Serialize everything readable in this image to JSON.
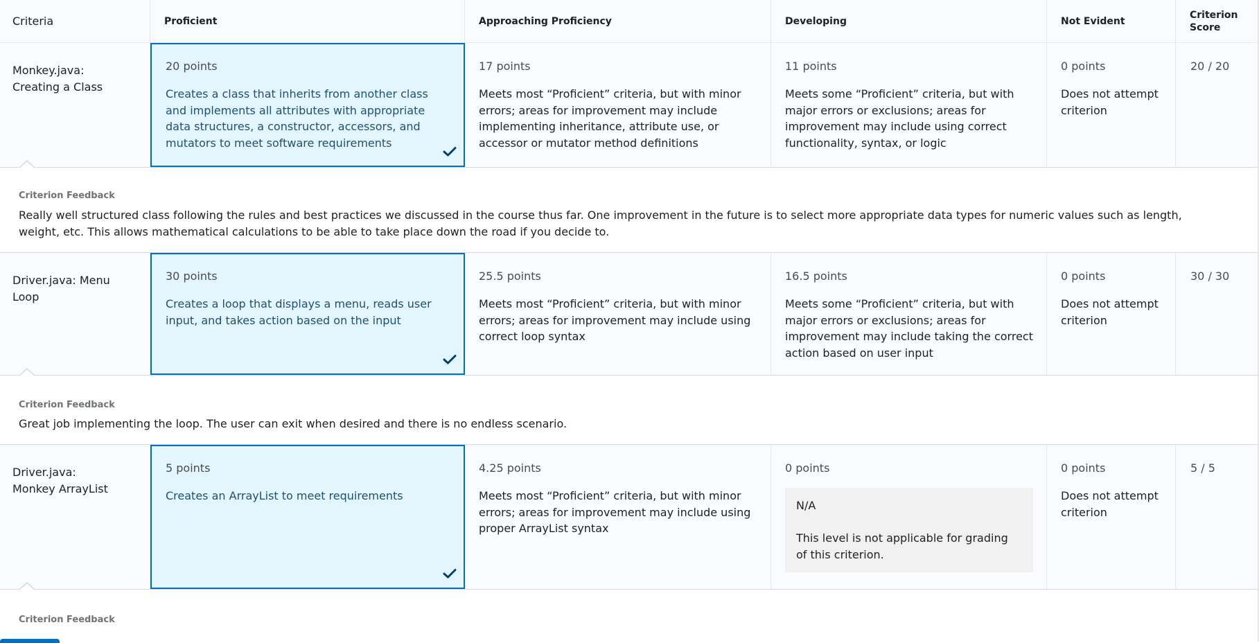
{
  "header": {
    "criteria": "Criteria",
    "proficient": "Proficient",
    "approaching": "Approaching Proficiency",
    "developing": "Developing",
    "not_evident": "Not Evident",
    "criterion_score": "Criterion Score"
  },
  "rows": [
    {
      "criterion": "Monkey.java: Creating a Class",
      "proficient": {
        "points": "20 points",
        "description": "Creates a class that inherits from another class and implements all attributes with appropriate data structures, a constructor, accessors, and mutators to meet software requirements"
      },
      "approaching": {
        "points": "17 points",
        "description": "Meets most “Proficient” criteria, but with minor errors; areas for improvement may include implementing inheritance, attribute use, or accessor or mutator method definitions"
      },
      "developing": {
        "points": "11 points",
        "description": "Meets some “Proficient” criteria, but with major errors or exclusions; areas for improvement may include using correct functionality, syntax, or logic"
      },
      "not_evident": {
        "points": "0 points",
        "description": "Does not attempt criterion"
      },
      "score": "20 / 20",
      "feedback_label": "Criterion Feedback",
      "feedback": "Really well structured class following the rules and best practices we discussed in the course thus far. One improvement in the future is to select more appropriate data types for numeric values such as length, weight, etc. This allows mathematical calculations to be able to take place down the road if you decide to."
    },
    {
      "criterion": "Driver.java: Menu Loop",
      "proficient": {
        "points": "30 points",
        "description": "Creates a loop that displays a menu, reads user input, and takes action based on the input"
      },
      "approaching": {
        "points": "25.5 points",
        "description": "Meets most “Proficient” criteria, but with minor errors; areas for improvement may include using correct loop syntax"
      },
      "developing": {
        "points": "16.5 points",
        "description": "Meets some “Proficient” criteria, but with major errors or exclusions; areas for improvement may include taking the correct action based on user input"
      },
      "not_evident": {
        "points": "0 points",
        "description": "Does not attempt criterion"
      },
      "score": "30 / 30",
      "feedback_label": "Criterion Feedback",
      "feedback": "Great job implementing the loop. The user can exit when desired and there is no endless scenario."
    },
    {
      "criterion": "Driver.java: Monkey ArrayList",
      "proficient": {
        "points": "5 points",
        "description": "Creates an ArrayList to meet requirements"
      },
      "approaching": {
        "points": "4.25 points",
        "description": "Meets most “Proficient” criteria, but with minor errors; areas for improvement may include using proper ArrayList syntax"
      },
      "developing": {
        "points": "0 points",
        "na_title": "N/A",
        "na_text": "This level is not applicable for grading of this criterion."
      },
      "not_evident": {
        "points": "0 points",
        "description": "Does not attempt criterion"
      },
      "score": "5 / 5",
      "feedback_label": "Criterion Feedback"
    }
  ],
  "colors": {
    "selected_bg": "#e3f6fd",
    "selected_border": "#006fbf",
    "checkmark": "#003e6b"
  }
}
